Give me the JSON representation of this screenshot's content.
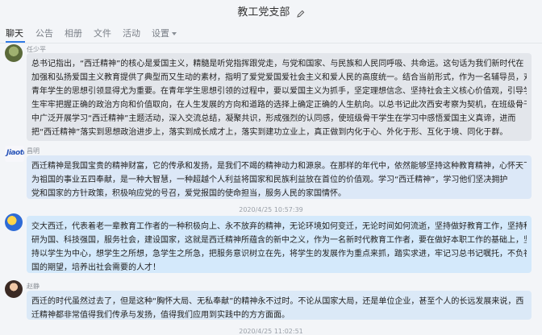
{
  "window": {
    "title": "教工党支部"
  },
  "tabs": [
    {
      "label": "聊天"
    },
    {
      "label": "公告"
    },
    {
      "label": "相册"
    },
    {
      "label": "文件"
    },
    {
      "label": "活动"
    },
    {
      "label": "设置"
    }
  ],
  "messages": [
    {
      "sender": "任少平",
      "lines": [
        "总书记指出，“西迁精神”的核心是爱国主义，精髓是听党指挥跟党走，与党和国家、与民族和人民同呼吸、共命运。这句话为我们新时代在",
        "加强和弘扬爱国主义教育提供了典型而又生动的素材，指明了爱党爱国爱社会主义和爱人民的高度统一。结合当前形式，作为一名辅导员，对",
        "青年学生的思想引领显得尤为重要。在青年学生思想引领的过程中，要以爱国主义为抓手，坚定理想信念、坚持社会主义核心价值观，引导学",
        "生牢牢把握正确的政治方向和价值取向，在人生发展的方向和道路的选择上确定正确的人生航向。以总书记此次西安考察为契机，在班级骨干",
        "中广泛开展学习“西迁精神”主题活动，深入交流总结，凝聚共识，形成强烈的认同感，使班级骨干学生在学习中感悟爱国主义真谛，进而",
        "把“西迁精神”落实到思想政治进步上，落实到成长成才上，落实到建功立业上，真正做到内化于心、外化于形、互化于境、同化于群。"
      ]
    },
    {
      "sender": "昌明",
      "avatar_text": "Jiaotong",
      "lines": [
        "西迁精神是我国宝贵的精神财富，它的传承和发扬，是我们不竭的精神动力和源泉。在那样的年代中，依然能够坚持这种教育精神，心怀天下，",
        "为祖国的事业五四奉献，是一种大智慧，一种超越个人利益将国家和民族利益放在首位的价值观。学习“西迁精神”，学习他们坚决拥护",
        "党和国家的方针政策，积极响应党的号召，爱党报国的使命担当，服务人民的家国情怀。"
      ]
    },
    {
      "sender": "",
      "timestamp": "2020/4/25 10:57:39",
      "lines": [
        "交大西迁，代表着老一辈教育工作者的一种积极向上、永不放弃的精神，无论环境如何变迁，无论时间如何流逝，坚持做好教育工作，坚持科",
        "研为国、科技强国，服务社会，建设国家，这就是西迁精神所蕴含的新中之义，作为一名新时代教育工作者，要在做好本职工作的基础上，坚",
        "持以学生为中心，想学生之所想，急学生之所急，把服务意识树立在先，将学生的发展作为重点来抓，踏实求进，牢记习总书记嘱托，不负祖",
        "国的期望，培养出社会需要的人才！"
      ]
    },
    {
      "sender": "赵静",
      "timestamp": "2020/4/25 11:02:51",
      "lines": [
        "西迁的时代虽然过去了，但是这种“胸怀大局、无私奉献”的精神永不过时。不论从国家大局，还是单位企业，甚至个人的长远发展来说，西",
        "迁精神都非常值得我们传承与发扬，值得我们应用到实践中的方方面面。"
      ]
    }
  ]
}
